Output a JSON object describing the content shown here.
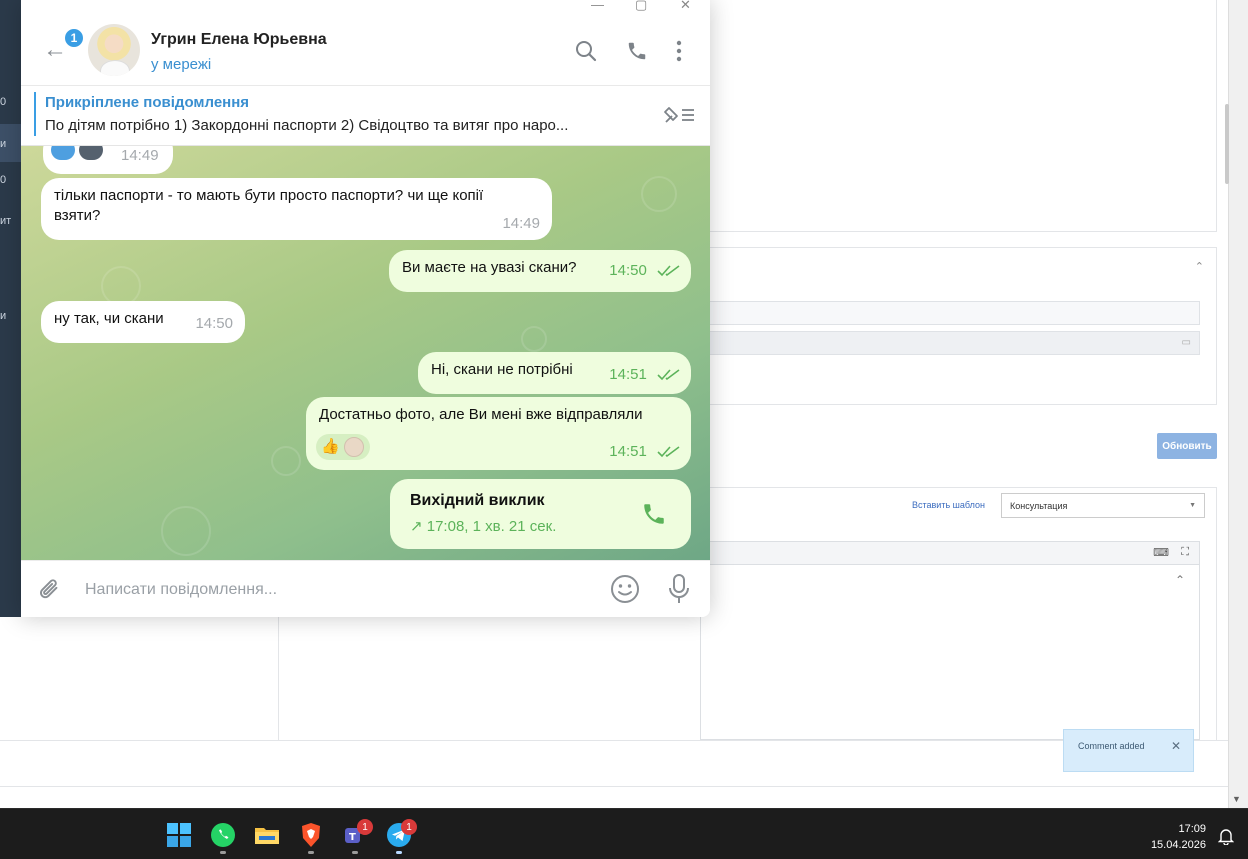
{
  "background": {
    "template_link": "Вставить шаблон",
    "template_select": "Консультация",
    "refresh_button": "Обновить",
    "toast": "Comment added"
  },
  "telegram": {
    "unread_badge": "1",
    "contact_name": "Угрин Елена Юрьевна",
    "contact_status": "у мережі",
    "pinned_title": "Прикріплене повідомлення",
    "pinned_text": "По дітям потрібно  1) Закордонні паспорти 2) Свідоцтво та витяг про наро...",
    "messages": [
      {
        "dir": "in",
        "text": "",
        "time": "14:49"
      },
      {
        "dir": "in",
        "text": "тільки паспорти - то мають бути просто паспорти? чи ще копії взяти?",
        "time": "14:49"
      },
      {
        "dir": "out",
        "text": "Ви маєте на увазі скани?",
        "time": "14:50"
      },
      {
        "dir": "in",
        "text": "ну так, чи скани",
        "time": "14:50"
      },
      {
        "dir": "out",
        "text": "Ні, скани не потрібні",
        "time": "14:51"
      },
      {
        "dir": "out",
        "text": "Достатньо фото, але Ви мені вже відправляли",
        "time": "14:51"
      }
    ],
    "call": {
      "title": "Вихідний виклик",
      "detail": "17:08, 1 хв. 21 сек."
    },
    "composer_placeholder": "Написати повідомлення..."
  },
  "taskbar": {
    "teams_badge": "1",
    "telegram_badge": "1",
    "time": "17:09",
    "date": "15.04.2026"
  },
  "colors": {
    "accent": "#3a9ee4",
    "outgoing_bubble": "#effdde",
    "check": "#5cb35a"
  }
}
